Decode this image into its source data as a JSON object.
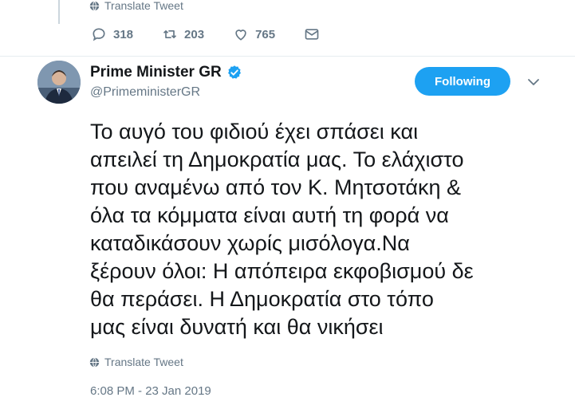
{
  "previous_tweet": {
    "translate_label": "Translate Tweet",
    "replies": "318",
    "retweets": "203",
    "likes": "765"
  },
  "tweet": {
    "display_name": "Prime Minister GR",
    "handle": "@PrimeministerGR",
    "follow_label": "Following",
    "text": "Το αυγό του φιδιού έχει σπάσει και\nαπειλεί τη Δημοκρατία μας. Το ελάχιστο\nπου αναμένω από τον Κ. Μητσοτάκη &\nόλα τα κόμματα είναι αυτή τη φορά να\nκαταδικάσουν χωρίς μισόλογα.Να\nξέρουν όλοι: Η απόπειρα εκφοβισμού δε\nθα περάσει. Η Δημοκρατία στο τόπο\nμας είναι δυνατή και θα νικήσει",
    "translate_label": "Translate Tweet",
    "timestamp": "6:08 PM - 23 Jan 2019"
  },
  "colors": {
    "accent": "#1da1f2",
    "muted": "#657786",
    "divider": "#e6ecf0"
  },
  "icons": [
    "globe-icon",
    "reply-icon",
    "retweet-icon",
    "like-icon",
    "direct-message-icon",
    "verified-badge-icon",
    "chevron-down-icon"
  ]
}
